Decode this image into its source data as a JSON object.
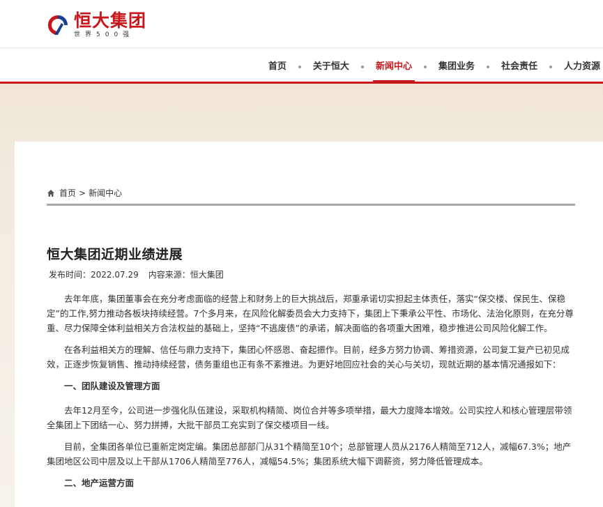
{
  "brand": {
    "name": "恒大集团",
    "subtitle": "世界500强",
    "color": "#c8161d"
  },
  "nav": {
    "items": [
      {
        "label": "首页",
        "active": false
      },
      {
        "label": "关于恒大",
        "active": false
      },
      {
        "label": "新闻中心",
        "active": true
      },
      {
        "label": "集团业务",
        "active": false
      },
      {
        "label": "社会责任",
        "active": false
      },
      {
        "label": "人力资源",
        "active": false
      }
    ]
  },
  "breadcrumb": {
    "icon": "home-icon",
    "home": "首页",
    "separator": ">",
    "current": "新闻中心"
  },
  "article": {
    "title": "恒大集团近期业绩进展",
    "publish_label": "发布时间：",
    "publish_date": "2022.07.29",
    "source_label": "内容来源：",
    "source": "恒大集团",
    "p1": "去年年底，集团董事会在充分考虑面临的经营上和财务上的巨大挑战后，郑重承诺切实担起主体责任，落实“保交楼、保民生、保稳定”的工作,努力推动各板块持续经营。7个多月来，在风险化解委员会大力支持下，集团上下秉承公平性、市场化、法治化原则，在充分尊重、尽力保障全体利益相关方合法权益的基础上，坚持“不逃废债”的承诺，解决面临的各项重大困难，稳步推进公司风险化解工作。",
    "p2": "在各利益相关方的理解、信任与鼎力支持下，集团心怀感恩、奋起振作。目前，经多方努力协调、筹措资源，公司复工复产已初见成效，正逐步恢复销售、推动持续经营，债务重组也正有条不紊推进。为更好地回应社会的关心与关切，现就近期的基本情况通报如下：",
    "h1": "一、团队建设及管理方面",
    "p3": "去年12月至今，公司进一步强化队伍建设，采取机构精简、岗位合并等多项举措，最大力度降本增效。公司实控人和核心管理层带领全集团上下团结一心、努力拼搏，大批干部员工充实到了保交楼项目一线。",
    "p4": "目前，全集团各单位已重新定岗定编。集团总部部门从31个精简至10个；总部管理人员从2176人精简至712人，减幅67.3%；地产集团地区公司中层及以上干部从1706人精简至776人，减幅54.5%；集团系统大幅下调薪资，努力降低管理成本。",
    "h2": "二、地产运营方面"
  }
}
